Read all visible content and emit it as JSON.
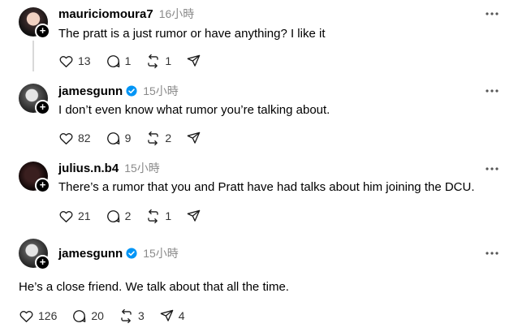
{
  "posts": [
    {
      "username": "mauriciomoura7",
      "time": "16小時",
      "text": "The pratt is a just rumor or have anything? I like it",
      "likes": "13",
      "replies": "1",
      "reposts": "1",
      "shares": "",
      "verified": false
    },
    {
      "username": "jamesgunn",
      "time": "15小時",
      "text": "I don’t even know what rumor you’re talking about.",
      "likes": "82",
      "replies": "9",
      "reposts": "2",
      "shares": "",
      "verified": true
    },
    {
      "username": "julius.n.b4",
      "time": "15小時",
      "text": "There’s a rumor that you and Pratt have had talks about him joining the DCU.",
      "likes": "21",
      "replies": "2",
      "reposts": "1",
      "shares": "",
      "verified": false
    },
    {
      "username": "jamesgunn",
      "time": "15小時",
      "text": "He’s a close friend. We talk about that all the time.",
      "likes": "126",
      "replies": "20",
      "reposts": "3",
      "shares": "4",
      "verified": true
    }
  ],
  "colors": {
    "verified": "#0095f6",
    "thread_line": "#d9d9d9",
    "muted": "#8a8a8a"
  },
  "icons": [
    "heart-icon",
    "comment-icon",
    "repost-icon",
    "share-icon",
    "more-icon",
    "verified-icon",
    "follow-plus-icon"
  ]
}
